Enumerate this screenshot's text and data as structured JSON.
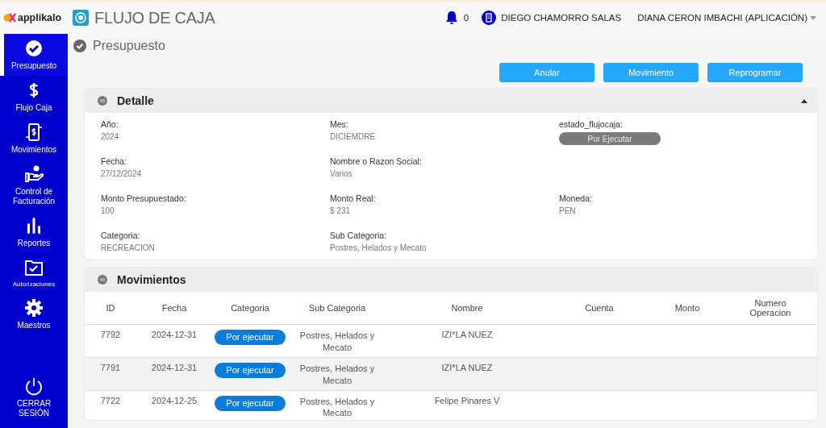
{
  "header": {
    "brand": "applikalo",
    "module": "FLUJO DE CAJA",
    "notifications": "0",
    "company": "DIEGO CHAMORRO SALAS",
    "user": "DIANA CERON IMBACHI (APLICACIÓN)"
  },
  "sidebar": {
    "items": [
      {
        "label": "Presupuesto",
        "kind": "check",
        "selected": true
      },
      {
        "label": "Flujo Caja",
        "kind": "dollar",
        "selected": false
      },
      {
        "label": "Movimientos",
        "kind": "phone",
        "selected": false
      },
      {
        "label": "Control de Facturación",
        "kind": "hand",
        "selected": false
      },
      {
        "label": "Reportes",
        "kind": "bars",
        "selected": false
      },
      {
        "label": "Autorizaciones",
        "kind": "folder",
        "selected": false
      },
      {
        "label": "Maestros",
        "kind": "gear",
        "selected": false
      }
    ],
    "logout": "CERRAR SESIÓN"
  },
  "page_title": "Presupuesto",
  "actions": [
    "Anular",
    "Movimiento",
    "Reprogramar"
  ],
  "detail": {
    "title": "Detalle",
    "expanded": true,
    "rows": [
      [
        {
          "label": "Año:",
          "value": "2024",
          "kind": "text"
        },
        {
          "label": "Mes:",
          "value": "DICIEMDRE",
          "kind": "text"
        },
        {
          "label": "estado_flujocaja:",
          "value": "Por Ejecutar",
          "kind": "badge"
        }
      ],
      [
        {
          "label": "Fecha:",
          "value": "27/12/2024",
          "kind": "text"
        },
        {
          "label": "Nombre o Razon Social:",
          "value": "Varios",
          "kind": "text"
        }
      ],
      [
        {
          "label": "Monto Presupuestado:",
          "value": "100",
          "kind": "text"
        },
        {
          "label": "Monto Real:",
          "value": "$ 231",
          "kind": "text"
        },
        {
          "label": "Moneda:",
          "value": "PEN",
          "kind": "text"
        }
      ],
      [
        {
          "label": "Categoria:",
          "value": "RECREACION",
          "kind": "text"
        },
        {
          "label": "Sub Categoria:",
          "value": "Postres, Helados y Mecato",
          "kind": "text"
        }
      ]
    ]
  },
  "movements": {
    "title": "Movimientos",
    "columns": [
      "ID",
      "Fecha",
      "Categoria",
      "Sub Categoria",
      "Nombre",
      "Cuenta",
      "Monto",
      "Numero Operacion"
    ],
    "rows": [
      {
        "id": "7792",
        "date": "2024-12-31",
        "category": "Por ejecutar",
        "subcategory": "Postres, Helados y Mecato",
        "name": "IZI*LA NUEZ"
      },
      {
        "id": "7791",
        "date": "2024-12-31",
        "category": "Por ejecutar",
        "subcategory": "Postres, Helados y Mecato",
        "name": "IZI*LA NUEZ"
      },
      {
        "id": "7722",
        "date": "2024-12-25",
        "category": "Por ejecutar",
        "subcategory": "Postres, Helados y Mecato",
        "name": "Felipe Pinares V"
      }
    ]
  }
}
